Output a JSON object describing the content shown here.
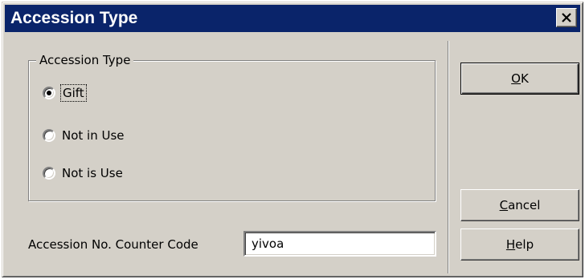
{
  "window": {
    "title": "Accession Type",
    "close_icon": "close-icon"
  },
  "group": {
    "legend": "Accession Type",
    "options": [
      {
        "label": "Gift",
        "selected": true
      },
      {
        "label": "Not in Use",
        "selected": false
      },
      {
        "label": "Not is Use",
        "selected": false
      }
    ]
  },
  "counter": {
    "label": "Accession No. Counter Code",
    "value": "yivoa"
  },
  "buttons": {
    "ok": {
      "mnemonic": "O",
      "rest": "K"
    },
    "cancel": {
      "mnemonic": "C",
      "rest": "ancel"
    },
    "help": {
      "mnemonic": "H",
      "rest": "elp"
    }
  },
  "colors": {
    "titlebar": "#0a246a",
    "face": "#d4d0c8"
  }
}
